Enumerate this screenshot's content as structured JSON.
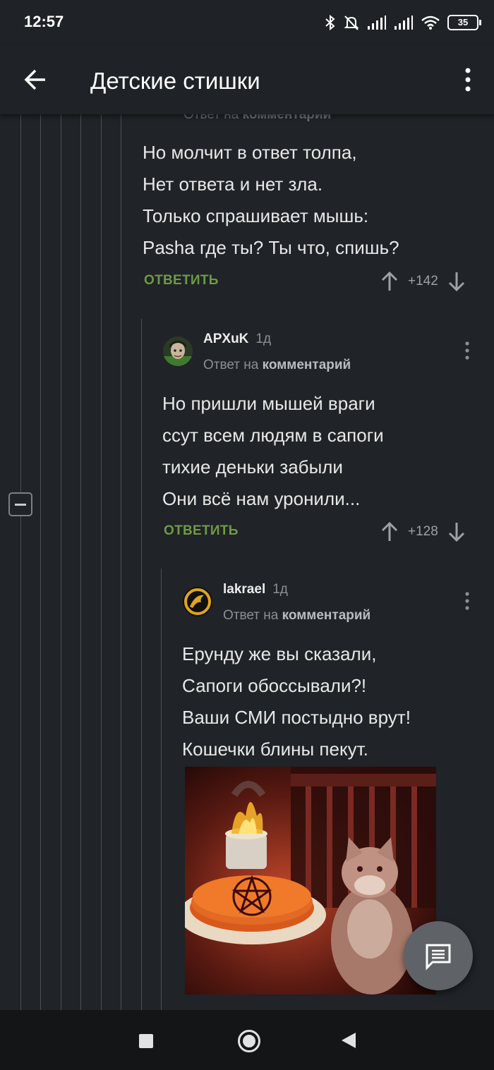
{
  "status_bar": {
    "time": "12:57",
    "battery": "35",
    "icons": [
      "bluetooth-icon",
      "mute-bell-icon",
      "signal-icon",
      "signal-icon",
      "wifi-icon",
      "battery-icon"
    ]
  },
  "app_bar": {
    "title": "Детские стишки",
    "back_icon": "arrow-left-icon",
    "menu_icon": "more-vertical-icon"
  },
  "comments": [
    {
      "reply_to_prefix": "Ответ на",
      "reply_to_target": "комментарий",
      "body": [
        "Но молчит в ответ толпа,",
        "Нет ответа и нет зла.",
        "Только спрашивает мышь:",
        "Pasha где ты? Ты что, спишь?"
      ],
      "reply_label": "ОТВЕТИТЬ",
      "rating": "+142"
    },
    {
      "author": "APXuK",
      "age": "1д",
      "reply_to_prefix": "Ответ на",
      "reply_to_target": "комментарий",
      "body": [
        "Но пришли мышей враги",
        "ссут всем людям в сапоги",
        "тихие деньки забыли",
        "Они всё нам уронили..."
      ],
      "reply_label": "ОТВЕТИТЬ",
      "rating": "+128"
    },
    {
      "author": "lakrael",
      "age": "1д",
      "reply_to_prefix": "Ответ на",
      "reply_to_target": "комментарий",
      "body": [
        "Ерунду же вы сказали,",
        "Сапоги обоссывали?!",
        "Ваши СМИ постыдно врут!",
        "Кошечки блины пекут."
      ],
      "image": "cat-with-pentagram-pancakes-image"
    }
  ],
  "fab": {
    "icon": "comment-icon"
  },
  "nav_bar": {
    "icons": [
      "recents-square-icon",
      "home-circle-icon",
      "back-triangle-icon"
    ]
  },
  "colors": {
    "background": "#202327",
    "app_bar": "#1f2226",
    "reply_green": "#6e9a43",
    "muted_text": "#8c9095",
    "thread_line": "#4b4f55"
  }
}
